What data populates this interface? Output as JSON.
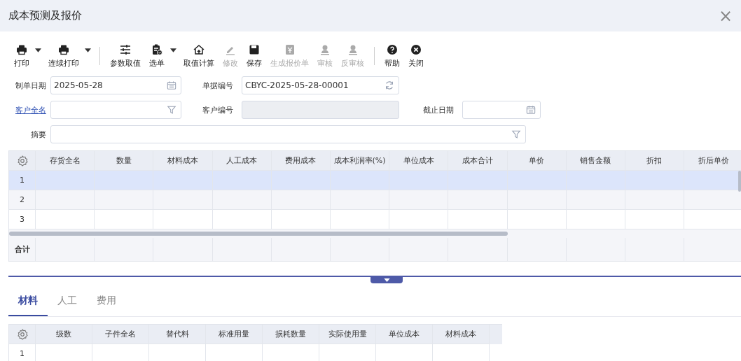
{
  "window": {
    "title": "成本预测及报价",
    "close": "×"
  },
  "toolbar": [
    {
      "kind": "button",
      "label": "打印",
      "dropdown": true,
      "disabled": false
    },
    {
      "kind": "button",
      "label": "连续打印",
      "dropdown": true,
      "disabled": false
    },
    {
      "kind": "separator"
    },
    {
      "kind": "button",
      "label": "参数取值",
      "dropdown": false,
      "disabled": false
    },
    {
      "kind": "button",
      "label": "选单",
      "dropdown": true,
      "disabled": false
    },
    {
      "kind": "button",
      "label": "取值计算",
      "dropdown": false,
      "disabled": false
    },
    {
      "kind": "button",
      "label": "修改",
      "dropdown": false,
      "disabled": true
    },
    {
      "kind": "button",
      "label": "保存",
      "dropdown": false,
      "disabled": false
    },
    {
      "kind": "button",
      "label": "生成报价单",
      "dropdown": false,
      "disabled": true
    },
    {
      "kind": "button",
      "label": "审核",
      "dropdown": false,
      "disabled": true
    },
    {
      "kind": "button",
      "label": "反审核",
      "dropdown": false,
      "disabled": true
    },
    {
      "kind": "separator"
    },
    {
      "kind": "button",
      "label": "帮助",
      "dropdown": false,
      "disabled": false
    },
    {
      "kind": "button",
      "label": "关闭",
      "dropdown": false,
      "disabled": false
    }
  ],
  "form": {
    "order_date": {
      "label": "制单日期",
      "value": "2025-05-28"
    },
    "doc_no": {
      "label": "单据编号",
      "value": "CBYC-2025-05-28-00001"
    },
    "customer_name": {
      "label": "客户全名"
    },
    "customer_code": {
      "label": "客户编号",
      "disabled": true
    },
    "end_date": {
      "label": "截止日期"
    },
    "summary": {
      "label": "摘要"
    }
  },
  "grid": {
    "columns": [
      "存货全名",
      "数量",
      "材料成本",
      "人工成本",
      "费用成本",
      "成本利润率(%)",
      "单位成本",
      "成本合计",
      "单价",
      "销售金额",
      "折扣",
      "折后单价"
    ],
    "rows": [
      {
        "number": "1",
        "selected": true
      },
      {
        "number": "2",
        "selected": false
      },
      {
        "number": "3",
        "selected": false
      }
    ],
    "total_label": "合计"
  },
  "tabs": [
    {
      "label": "材料",
      "selected": true
    },
    {
      "label": "人工",
      "selected": false
    },
    {
      "label": "费用",
      "selected": false
    }
  ],
  "sub_grid": {
    "columns": [
      "级数",
      "子件全名",
      "替代料",
      "标准用量",
      "损耗数量",
      "实际使用量",
      "单位成本",
      "材料成本"
    ],
    "rows": [
      {
        "number": "1"
      }
    ]
  }
}
